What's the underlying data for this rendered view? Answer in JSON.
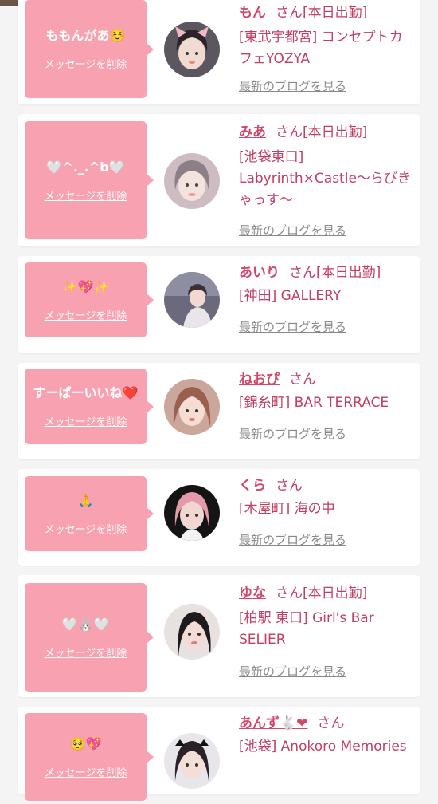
{
  "cards": [
    {
      "message": "ももんがあ☺️",
      "delete_label": "メッセージを削除",
      "name": "もん",
      "san": "さん",
      "tag": "[本日出勤]",
      "shop": "[東武宇都宮] コンセプトカフェYOZYA",
      "blog_label": "最新のブログを見る"
    },
    {
      "message": "🤍^._.^b🤍",
      "delete_label": "メッセージを削除",
      "name": "みあ",
      "san": "さん",
      "tag": "[本日出勤]",
      "shop": "[池袋東口] Labyrinth×Castle〜らびきゃっす〜",
      "blog_label": "最新のブログを見る"
    },
    {
      "message": "✨💖✨",
      "delete_label": "メッセージを削除",
      "name": "あいり",
      "san": "さん",
      "tag": "[本日出勤]",
      "shop": "[神田] GALLERY",
      "blog_label": "最新のブログを見る"
    },
    {
      "message": "すーぱーいいね❤️",
      "delete_label": "メッセージを削除",
      "name": "ねおぴ",
      "san": "さん",
      "tag": "",
      "shop": "[錦糸町] BAR TERRACE",
      "blog_label": "最新のブログを見る"
    },
    {
      "message": "🙏",
      "delete_label": "メッセージを削除",
      "name": "くら",
      "san": "さん",
      "tag": "",
      "shop": "[木屋町] 海の中",
      "blog_label": "最新のブログを見る"
    },
    {
      "message": "🤍🐰🤍",
      "delete_label": "メッセージを削除",
      "name": "ゆな",
      "san": "さん",
      "tag": "[本日出勤]",
      "shop": "[柏駅 東口] Girl's Bar SELIER",
      "blog_label": "最新のブログを見る"
    },
    {
      "message": "🥺💖",
      "delete_label": "メッセージを削除",
      "name": "あんず🐇❤",
      "san": "さん",
      "tag": "",
      "shop": "[池袋] Anokoro Memories",
      "blog_label": ""
    }
  ]
}
